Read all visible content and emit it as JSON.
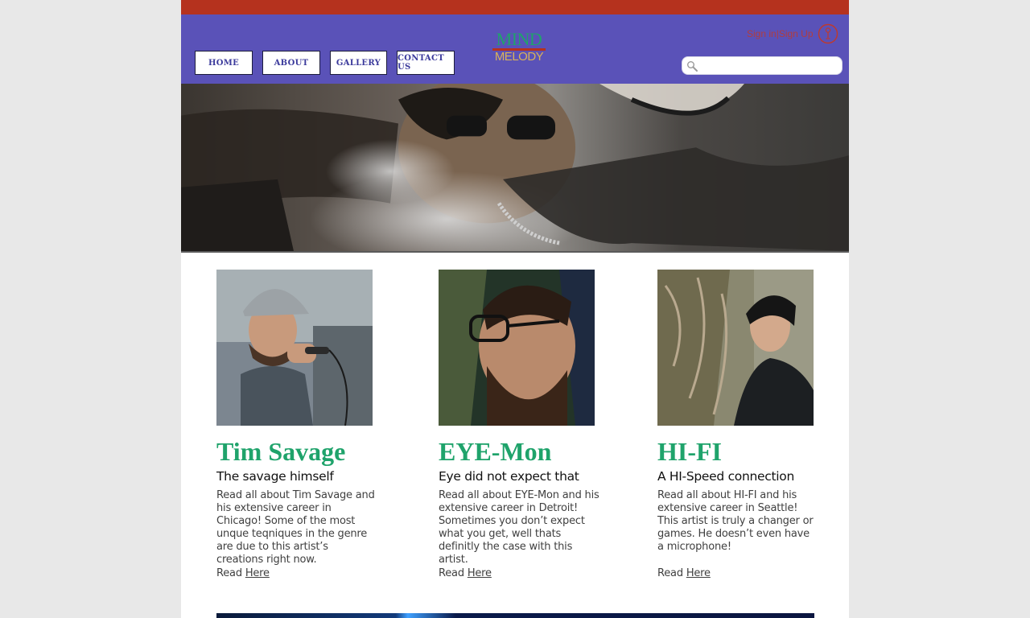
{
  "colors": {
    "top_strip": "#b5321e",
    "header_bg": "#5a52b8",
    "accent_green": "#1fa36b",
    "auth_red": "#c0392b",
    "logo_gold": "#d9b25a"
  },
  "nav": {
    "home": "HOME",
    "about": "ABOUT",
    "gallery": "GALLERY",
    "contact": "CONTACT US"
  },
  "logo": {
    "line1": "MIND",
    "line2": "MELODY"
  },
  "auth": {
    "sign_in": "Sign in",
    "separator": "|",
    "sign_up": "Sign Up",
    "icon": "user-circle-icon"
  },
  "search": {
    "value": "",
    "placeholder": "",
    "icon": "magnifier-icon"
  },
  "hero": {
    "image": "banner photo of artist smoking with sunglasses and smiling face"
  },
  "artists": [
    {
      "name": "Tim Savage",
      "tagline": "The savage himself",
      "body": "Read all about Tim Savage and his extensive career in Chicago! Some of the most unque teqniques in the genre are due to this artist’s creations right now.",
      "read_prefix": "Read",
      "read_link": "Here"
    },
    {
      "name": "EYE-Mon",
      "tagline": "Eye did not expect that",
      "body": "Read all about EYE-Mon and his extensive career in Detroit! Sometimes you don’t expect what you get, well thats definitly the case with this artist.",
      "read_prefix": "Read",
      "read_link": "Here"
    },
    {
      "name": "HI-FI",
      "tagline": "A HI-Speed connection",
      "body": "Read all about HI-FI and his extensive career in Seattle! This artist is truly a changer or games. He doesn’t even have a microphone!",
      "read_prefix": "Read",
      "read_link": "Here"
    }
  ]
}
